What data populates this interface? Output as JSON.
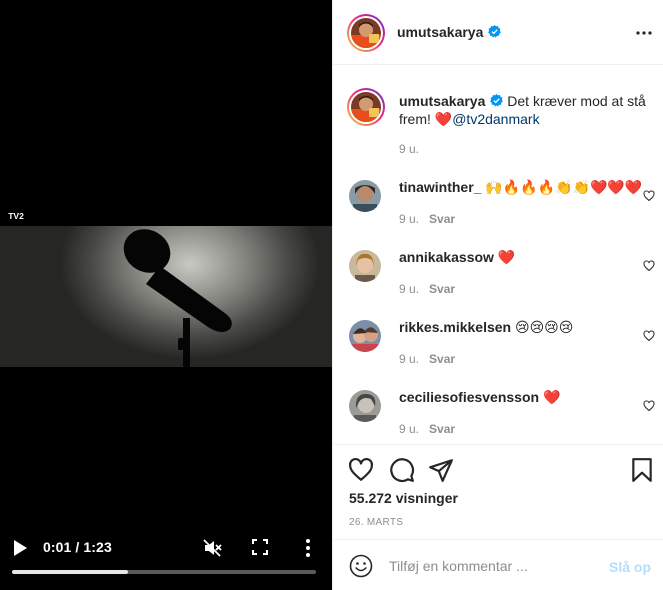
{
  "video": {
    "channel_logo_text": "TV2",
    "current_time": "0:01",
    "separator": " / ",
    "duration": "1:23",
    "progress_fraction": 0.38
  },
  "post": {
    "author": "umutsakarya",
    "caption_text": " Det kræver mod at stå frem! ❤️",
    "caption_mention": "@tv2danmark",
    "caption_time": "9 u.",
    "views_count": "55.272",
    "views_label": "visninger",
    "date": "26. MARTS"
  },
  "comments": [
    {
      "user": "tinawinther_",
      "text": "🙌🔥🔥🔥👏👏❤️❤️❤️",
      "time": "9 u.",
      "reply": "Svar"
    },
    {
      "user": "annikakassow",
      "text": "❤️",
      "time": "9 u.",
      "reply": "Svar"
    },
    {
      "user": "rikkes.mikkelsen",
      "text": "😢😢😢😢",
      "time": "9 u.",
      "reply": "Svar"
    },
    {
      "user": "ceciliesofiesvensson",
      "text": "❤️",
      "time": "9 u.",
      "reply": "Svar"
    }
  ],
  "composer": {
    "placeholder": "Tilføj en kommentar ...",
    "post_label": "Slå op"
  },
  "colors": {
    "verified_blue": "#0095f6",
    "link": "#00376b",
    "secondary_text": "#8e8e8e",
    "post_button_disabled": "#b2dffc"
  },
  "icons": {
    "play": "play-icon",
    "mute": "muted-speaker-icon",
    "fullscreen": "fullscreen-icon",
    "more": "vertical-dots-icon",
    "options": "horizontal-dots-icon",
    "like": "heart-icon",
    "comment": "speech-bubble-icon",
    "share": "paper-plane-icon",
    "save": "bookmark-icon",
    "emoji": "smiley-icon"
  }
}
